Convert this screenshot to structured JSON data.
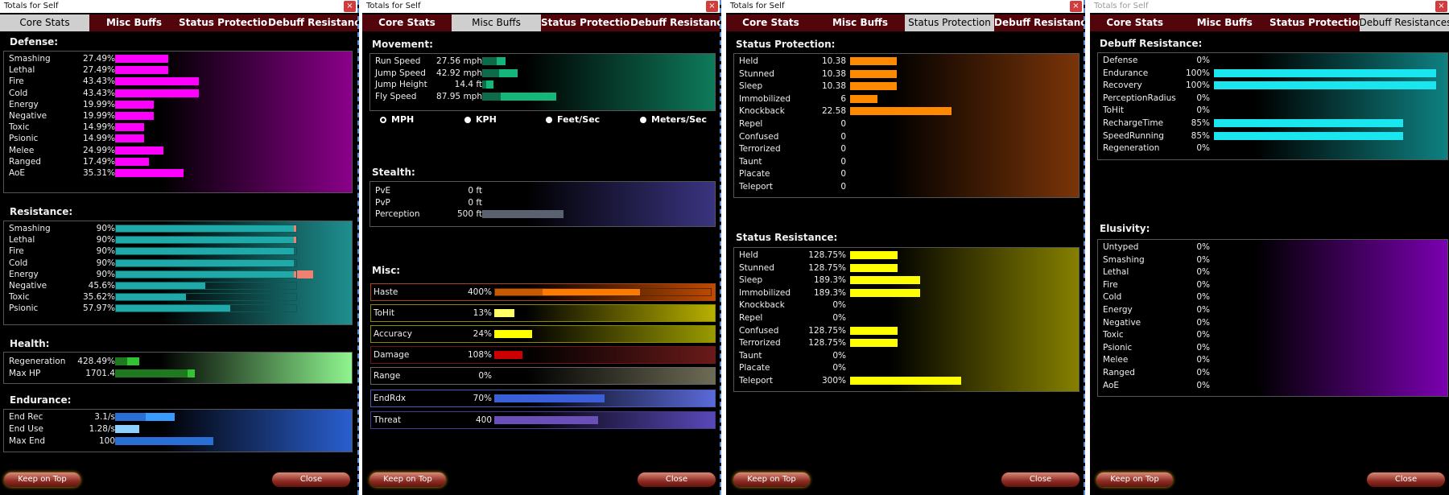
{
  "window_title": "Totals for Self",
  "close_x": "×",
  "tabs": [
    "Core Stats",
    "Misc Buffs",
    "Status Protection",
    "Debuff Resistances"
  ],
  "buttons": {
    "keep": "Keep on Top",
    "close": "Close"
  },
  "core": {
    "defense_title": "Defense:",
    "defense": [
      {
        "label": "Smashing",
        "value": "27.49%",
        "level": 27.49
      },
      {
        "label": "Lethal",
        "value": "27.49%",
        "level": 27.49
      },
      {
        "label": "Fire",
        "value": "43.43%",
        "level": 43.43
      },
      {
        "label": "Cold",
        "value": "43.43%",
        "level": 43.43
      },
      {
        "label": "Energy",
        "value": "19.99%",
        "level": 19.99
      },
      {
        "label": "Negative",
        "value": "19.99%",
        "level": 19.99
      },
      {
        "label": "Toxic",
        "value": "14.99%",
        "level": 14.99
      },
      {
        "label": "Psionic",
        "value": "14.99%",
        "level": 14.99
      },
      {
        "label": "Melee",
        "value": "24.99%",
        "level": 24.99
      },
      {
        "label": "Ranged",
        "value": "17.49%",
        "level": 17.49
      },
      {
        "label": "AoE",
        "value": "35.31%",
        "level": 35.31
      }
    ],
    "resistance_title": "Resistance:",
    "resistance": [
      {
        "label": "Smashing",
        "value": "90%",
        "level": 90,
        "over": 1
      },
      {
        "label": "Lethal",
        "value": "90%",
        "level": 90,
        "over": 1
      },
      {
        "label": "Fire",
        "value": "90%",
        "level": 90,
        "over": 0
      },
      {
        "label": "Cold",
        "value": "90%",
        "level": 90,
        "over": 0
      },
      {
        "label": "Energy",
        "value": "90%",
        "level": 90,
        "over": 10
      },
      {
        "label": "Negative",
        "value": "45.6%",
        "level": 45.6,
        "over": 0
      },
      {
        "label": "Toxic",
        "value": "35.62%",
        "level": 35.62,
        "over": 0
      },
      {
        "label": "Psionic",
        "value": "57.97%",
        "level": 57.97,
        "over": 0
      }
    ],
    "health_title": "Health:",
    "health": [
      {
        "label": "Regeneration",
        "value": "428.49%",
        "level": 10,
        "hi": 20
      },
      {
        "label": "Max HP",
        "value": "1701.4",
        "level": 60,
        "hi": 66
      }
    ],
    "endurance_title": "Endurance:",
    "endurance": [
      {
        "label": "End Rec",
        "value": "3.1/s",
        "level": 24,
        "hi": 46
      },
      {
        "label": "End Use",
        "value": "1.28/s",
        "level": 19,
        "hi": 0
      },
      {
        "label": "Max End",
        "value": "100",
        "level": 76,
        "hi": 0
      }
    ]
  },
  "misc": {
    "movement_title": "Movement:",
    "movement": [
      {
        "label": "Run Speed",
        "value": "27.56 mph",
        "level": 12,
        "hi": 19
      },
      {
        "label": "Jump Speed",
        "value": "42.92 mph",
        "level": 14,
        "hi": 29
      },
      {
        "label": "Jump Height",
        "value": "14.4 ft",
        "level": 3,
        "hi": 9
      },
      {
        "label": "Fly Speed",
        "value": "87.95 mph",
        "level": 15,
        "hi": 61
      }
    ],
    "units": [
      {
        "label": "MPH",
        "selected": true
      },
      {
        "label": "KPH",
        "selected": false
      },
      {
        "label": "Feet/Sec",
        "selected": false
      },
      {
        "label": "Meters/Sec",
        "selected": false
      }
    ],
    "stealth_title": "Stealth:",
    "stealth": [
      {
        "label": "PvE",
        "value": "0 ft",
        "level": 0
      },
      {
        "label": "PvP",
        "value": "0 ft",
        "level": 0
      },
      {
        "label": "Perception",
        "value": "500 ft",
        "level": 63
      }
    ],
    "misc_title": "Misc:",
    "misc_rows": [
      {
        "label": "Haste",
        "value": "400%",
        "level": 93,
        "hi": 34
      },
      {
        "label": "ToHit",
        "value": "13%",
        "level": 13
      },
      {
        "label": "Accuracy",
        "value": "24%",
        "level": 24
      },
      {
        "label": "Damage",
        "value": "108%",
        "level": 18
      },
      {
        "label": "Range",
        "value": "0%",
        "level": 0
      },
      {
        "label": "EndRdx",
        "value": "70%",
        "level": 70
      },
      {
        "label": "Threat",
        "value": "400",
        "level": 66
      }
    ]
  },
  "status": {
    "protection_title": "Status Protection:",
    "protection": [
      {
        "label": "Held",
        "value": "10.38",
        "level": 10.38
      },
      {
        "label": "Stunned",
        "value": "10.38",
        "level": 10.38
      },
      {
        "label": "Sleep",
        "value": "10.38",
        "level": 10.38
      },
      {
        "label": "Immobilized",
        "value": "6",
        "level": 6
      },
      {
        "label": "Knockback",
        "value": "22.58",
        "level": 22.58
      },
      {
        "label": "Repel",
        "value": "0",
        "level": 0
      },
      {
        "label": "Confused",
        "value": "0",
        "level": 0
      },
      {
        "label": "Terrorized",
        "value": "0",
        "level": 0
      },
      {
        "label": "Taunt",
        "value": "0",
        "level": 0
      },
      {
        "label": "Placate",
        "value": "0",
        "level": 0
      },
      {
        "label": "Teleport",
        "value": "0",
        "level": 0
      }
    ],
    "resistance_title": "Status Resistance:",
    "resistance": [
      {
        "label": "Held",
        "value": "128.75%",
        "level": 128.75
      },
      {
        "label": "Stunned",
        "value": "128.75%",
        "level": 128.75
      },
      {
        "label": "Sleep",
        "value": "189.3%",
        "level": 189.3
      },
      {
        "label": "Immobilized",
        "value": "189.3%",
        "level": 189.3
      },
      {
        "label": "Knockback",
        "value": "0%",
        "level": 0
      },
      {
        "label": "Repel",
        "value": "0%",
        "level": 0
      },
      {
        "label": "Confused",
        "value": "128.75%",
        "level": 128.75
      },
      {
        "label": "Terrorized",
        "value": "128.75%",
        "level": 128.75
      },
      {
        "label": "Taunt",
        "value": "0%",
        "level": 0
      },
      {
        "label": "Placate",
        "value": "0%",
        "level": 0
      },
      {
        "label": "Teleport",
        "value": "300%",
        "level": 300
      }
    ]
  },
  "debuff": {
    "debuff_title": "Debuff Resistance:",
    "debuff": [
      {
        "label": "Defense",
        "value": "0%",
        "level": 0
      },
      {
        "label": "Endurance",
        "value": "100%",
        "level": 100
      },
      {
        "label": "Recovery",
        "value": "100%",
        "level": 100
      },
      {
        "label": "PerceptionRadius",
        "value": "0%",
        "level": 0
      },
      {
        "label": "ToHit",
        "value": "0%",
        "level": 0
      },
      {
        "label": "RechargeTime",
        "value": "85%",
        "level": 85
      },
      {
        "label": "SpeedRunning",
        "value": "85%",
        "level": 85
      },
      {
        "label": "Regeneration",
        "value": "0%",
        "level": 0
      }
    ],
    "elusivity_title": "Elusivity:",
    "elusivity": [
      {
        "label": "Untyped",
        "value": "0%"
      },
      {
        "label": "Smashing",
        "value": "0%"
      },
      {
        "label": "Lethal",
        "value": "0%"
      },
      {
        "label": "Fire",
        "value": "0%"
      },
      {
        "label": "Cold",
        "value": "0%"
      },
      {
        "label": "Energy",
        "value": "0%"
      },
      {
        "label": "Negative",
        "value": "0%"
      },
      {
        "label": "Toxic",
        "value": "0%"
      },
      {
        "label": "Psionic",
        "value": "0%"
      },
      {
        "label": "Melee",
        "value": "0%"
      },
      {
        "label": "Ranged",
        "value": "0%"
      },
      {
        "label": "AoE",
        "value": "0%"
      }
    ]
  },
  "colors": {
    "defense": "#ff00ff",
    "resistance": "#1fa9a9",
    "health": "#2e9d2e",
    "endurance": "#2a6fd6",
    "movement": "#14b77a",
    "protection": "#ff8a00",
    "status_res": "#ffff00",
    "debuff": "#19e6ef",
    "tab_bg": "#52060c",
    "tab_active": "#cfcfcf"
  }
}
